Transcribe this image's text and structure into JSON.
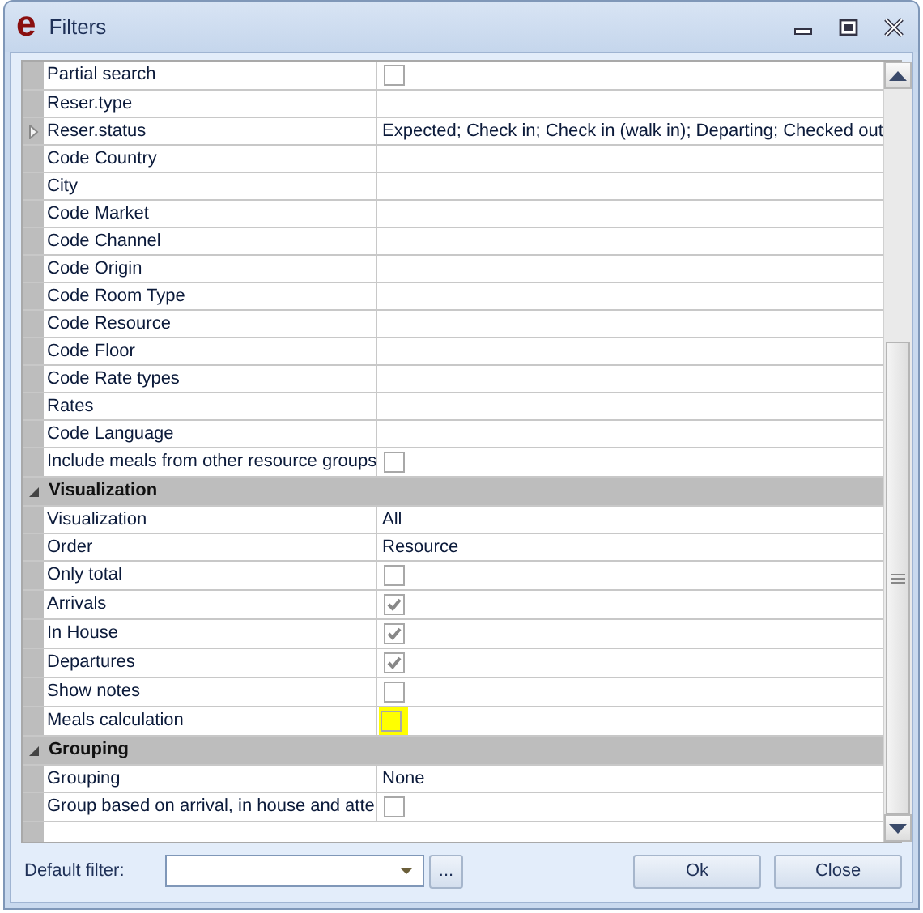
{
  "window": {
    "title": "Filters",
    "app_letter": "e"
  },
  "grid": {
    "sections": [
      {
        "rows": [
          {
            "label": "Partial search",
            "kind": "check",
            "checked": false,
            "current": false,
            "highlighted": false
          },
          {
            "label": "Reser.type",
            "kind": "text",
            "value": null,
            "current": false
          },
          {
            "label": "Reser.status",
            "kind": "text",
            "value": "Expected; Check in; Check in (walk in); Departing; Checked out",
            "current": true
          },
          {
            "label": "Code Country",
            "kind": "text",
            "value": null,
            "current": false
          },
          {
            "label": "City",
            "kind": "text",
            "value": null,
            "current": false
          },
          {
            "label": "Code Market",
            "kind": "text",
            "value": null,
            "current": false
          },
          {
            "label": "Code Channel",
            "kind": "text",
            "value": null,
            "current": false
          },
          {
            "label": "Code Origin",
            "kind": "text",
            "value": null,
            "current": false
          },
          {
            "label": "Code Room Type",
            "kind": "text",
            "value": null,
            "current": false
          },
          {
            "label": "Code Resource",
            "kind": "text",
            "value": null,
            "current": false
          },
          {
            "label": "Code Floor",
            "kind": "text",
            "value": null,
            "current": false
          },
          {
            "label": "Code Rate types",
            "kind": "text",
            "value": null,
            "current": false
          },
          {
            "label": "Rates",
            "kind": "text",
            "value": null,
            "current": false
          },
          {
            "label": "Code Language",
            "kind": "text",
            "value": null,
            "current": false
          },
          {
            "label": "Include meals from other resource groups",
            "kind": "check",
            "checked": false,
            "current": false,
            "highlighted": false
          }
        ]
      },
      {
        "title": "Visualization",
        "expanded": true,
        "rows": [
          {
            "label": "Visualization",
            "kind": "text",
            "value": "All",
            "current": false
          },
          {
            "label": "Order",
            "kind": "text",
            "value": "Resource",
            "current": false
          },
          {
            "label": "Only total",
            "kind": "check",
            "checked": false,
            "current": false,
            "highlighted": false
          },
          {
            "label": "Arrivals",
            "kind": "check",
            "checked": true,
            "current": false,
            "highlighted": false
          },
          {
            "label": "In House",
            "kind": "check",
            "checked": true,
            "current": false,
            "highlighted": false
          },
          {
            "label": "Departures",
            "kind": "check",
            "checked": true,
            "current": false,
            "highlighted": false
          },
          {
            "label": "Show notes",
            "kind": "check",
            "checked": false,
            "current": false,
            "highlighted": false
          },
          {
            "label": "Meals calculation",
            "kind": "check",
            "checked": false,
            "current": false,
            "highlighted": true
          }
        ]
      },
      {
        "title": "Grouping",
        "expanded": true,
        "rows": [
          {
            "label": "Grouping",
            "kind": "text",
            "value": "None",
            "current": false
          },
          {
            "label": "Group based on arrival, in house and atte",
            "kind": "check",
            "checked": false,
            "current": false,
            "highlighted": false
          }
        ]
      }
    ]
  },
  "footer": {
    "default_filter_label": "Default filter:",
    "browse_button": "...",
    "buttons": [
      "Ok",
      "Close"
    ]
  }
}
